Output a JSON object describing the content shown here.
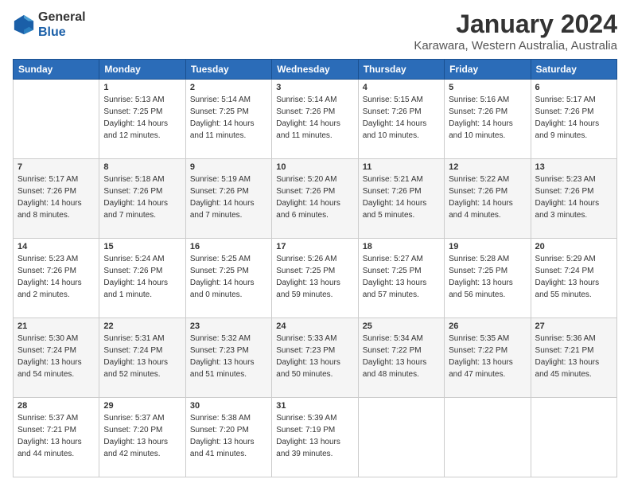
{
  "header": {
    "logo_line1": "General",
    "logo_line2": "Blue",
    "title": "January 2024",
    "subtitle": "Karawara, Western Australia, Australia"
  },
  "columns": [
    "Sunday",
    "Monday",
    "Tuesday",
    "Wednesday",
    "Thursday",
    "Friday",
    "Saturday"
  ],
  "weeks": [
    [
      {
        "day": "",
        "info": ""
      },
      {
        "day": "1",
        "info": "Sunrise: 5:13 AM\nSunset: 7:25 PM\nDaylight: 14 hours\nand 12 minutes."
      },
      {
        "day": "2",
        "info": "Sunrise: 5:14 AM\nSunset: 7:25 PM\nDaylight: 14 hours\nand 11 minutes."
      },
      {
        "day": "3",
        "info": "Sunrise: 5:14 AM\nSunset: 7:26 PM\nDaylight: 14 hours\nand 11 minutes."
      },
      {
        "day": "4",
        "info": "Sunrise: 5:15 AM\nSunset: 7:26 PM\nDaylight: 14 hours\nand 10 minutes."
      },
      {
        "day": "5",
        "info": "Sunrise: 5:16 AM\nSunset: 7:26 PM\nDaylight: 14 hours\nand 10 minutes."
      },
      {
        "day": "6",
        "info": "Sunrise: 5:17 AM\nSunset: 7:26 PM\nDaylight: 14 hours\nand 9 minutes."
      }
    ],
    [
      {
        "day": "7",
        "info": "Sunrise: 5:17 AM\nSunset: 7:26 PM\nDaylight: 14 hours\nand 8 minutes."
      },
      {
        "day": "8",
        "info": "Sunrise: 5:18 AM\nSunset: 7:26 PM\nDaylight: 14 hours\nand 7 minutes."
      },
      {
        "day": "9",
        "info": "Sunrise: 5:19 AM\nSunset: 7:26 PM\nDaylight: 14 hours\nand 7 minutes."
      },
      {
        "day": "10",
        "info": "Sunrise: 5:20 AM\nSunset: 7:26 PM\nDaylight: 14 hours\nand 6 minutes."
      },
      {
        "day": "11",
        "info": "Sunrise: 5:21 AM\nSunset: 7:26 PM\nDaylight: 14 hours\nand 5 minutes."
      },
      {
        "day": "12",
        "info": "Sunrise: 5:22 AM\nSunset: 7:26 PM\nDaylight: 14 hours\nand 4 minutes."
      },
      {
        "day": "13",
        "info": "Sunrise: 5:23 AM\nSunset: 7:26 PM\nDaylight: 14 hours\nand 3 minutes."
      }
    ],
    [
      {
        "day": "14",
        "info": "Sunrise: 5:23 AM\nSunset: 7:26 PM\nDaylight: 14 hours\nand 2 minutes."
      },
      {
        "day": "15",
        "info": "Sunrise: 5:24 AM\nSunset: 7:26 PM\nDaylight: 14 hours\nand 1 minute."
      },
      {
        "day": "16",
        "info": "Sunrise: 5:25 AM\nSunset: 7:25 PM\nDaylight: 14 hours\nand 0 minutes."
      },
      {
        "day": "17",
        "info": "Sunrise: 5:26 AM\nSunset: 7:25 PM\nDaylight: 13 hours\nand 59 minutes."
      },
      {
        "day": "18",
        "info": "Sunrise: 5:27 AM\nSunset: 7:25 PM\nDaylight: 13 hours\nand 57 minutes."
      },
      {
        "day": "19",
        "info": "Sunrise: 5:28 AM\nSunset: 7:25 PM\nDaylight: 13 hours\nand 56 minutes."
      },
      {
        "day": "20",
        "info": "Sunrise: 5:29 AM\nSunset: 7:24 PM\nDaylight: 13 hours\nand 55 minutes."
      }
    ],
    [
      {
        "day": "21",
        "info": "Sunrise: 5:30 AM\nSunset: 7:24 PM\nDaylight: 13 hours\nand 54 minutes."
      },
      {
        "day": "22",
        "info": "Sunrise: 5:31 AM\nSunset: 7:24 PM\nDaylight: 13 hours\nand 52 minutes."
      },
      {
        "day": "23",
        "info": "Sunrise: 5:32 AM\nSunset: 7:23 PM\nDaylight: 13 hours\nand 51 minutes."
      },
      {
        "day": "24",
        "info": "Sunrise: 5:33 AM\nSunset: 7:23 PM\nDaylight: 13 hours\nand 50 minutes."
      },
      {
        "day": "25",
        "info": "Sunrise: 5:34 AM\nSunset: 7:22 PM\nDaylight: 13 hours\nand 48 minutes."
      },
      {
        "day": "26",
        "info": "Sunrise: 5:35 AM\nSunset: 7:22 PM\nDaylight: 13 hours\nand 47 minutes."
      },
      {
        "day": "27",
        "info": "Sunrise: 5:36 AM\nSunset: 7:21 PM\nDaylight: 13 hours\nand 45 minutes."
      }
    ],
    [
      {
        "day": "28",
        "info": "Sunrise: 5:37 AM\nSunset: 7:21 PM\nDaylight: 13 hours\nand 44 minutes."
      },
      {
        "day": "29",
        "info": "Sunrise: 5:37 AM\nSunset: 7:20 PM\nDaylight: 13 hours\nand 42 minutes."
      },
      {
        "day": "30",
        "info": "Sunrise: 5:38 AM\nSunset: 7:20 PM\nDaylight: 13 hours\nand 41 minutes."
      },
      {
        "day": "31",
        "info": "Sunrise: 5:39 AM\nSunset: 7:19 PM\nDaylight: 13 hours\nand 39 minutes."
      },
      {
        "day": "",
        "info": ""
      },
      {
        "day": "",
        "info": ""
      },
      {
        "day": "",
        "info": ""
      }
    ]
  ]
}
